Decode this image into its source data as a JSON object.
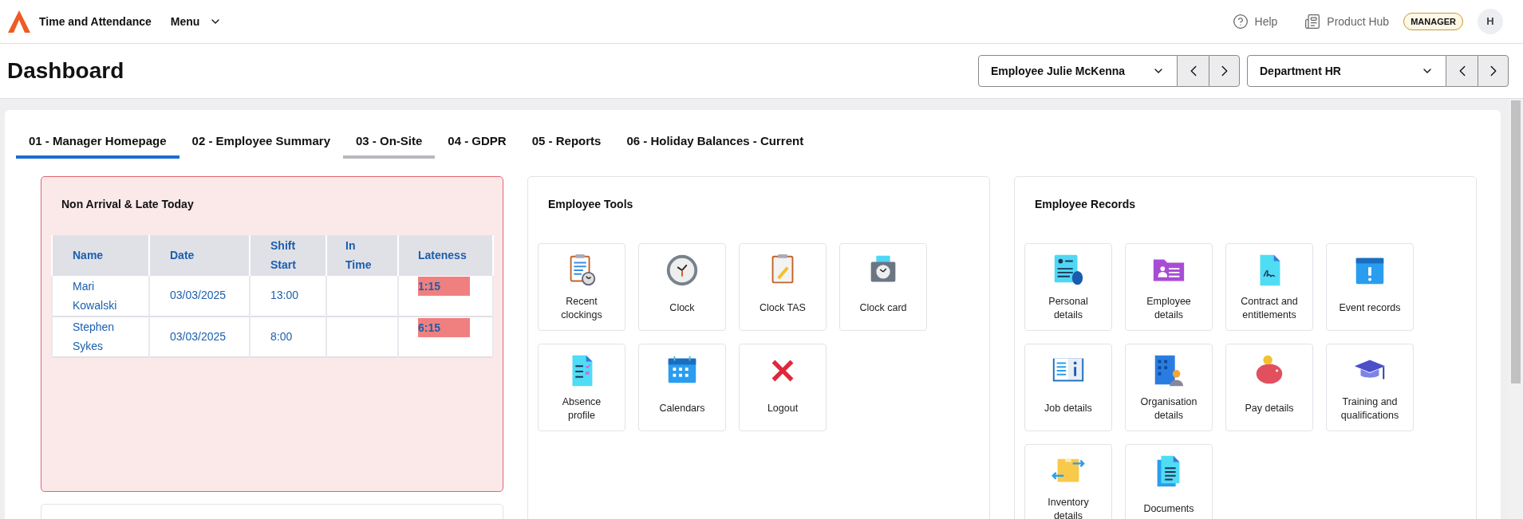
{
  "header": {
    "app_title": "Time and Attendance",
    "menu": "Menu",
    "help": "Help",
    "product_hub": "Product Hub",
    "role_badge": "MANAGER",
    "avatar": "H"
  },
  "page": {
    "title": "Dashboard",
    "employee_select": "Employee Julie McKenna",
    "department_select": "Department HR"
  },
  "tabs": [
    {
      "label": "01 - Manager Homepage",
      "selected": true,
      "hovered": false
    },
    {
      "label": "02 - Employee Summary",
      "selected": false,
      "hovered": false
    },
    {
      "label": "03 - On-Site",
      "selected": false,
      "hovered": true
    },
    {
      "label": "04 - GDPR",
      "selected": false,
      "hovered": false
    },
    {
      "label": "05 - Reports",
      "selected": false,
      "hovered": false
    },
    {
      "label": "06 - Holiday Balances - Current",
      "selected": false,
      "hovered": false
    }
  ],
  "late_panel": {
    "title": "Non Arrival & Late Today",
    "columns": [
      "Name",
      "Date",
      "Shift Start",
      "In Time",
      "Lateness"
    ],
    "rows": [
      {
        "name": "Mari Kowalski",
        "date": "03/03/2025",
        "shift_start": "13:00",
        "in_time": "",
        "lateness": "1:15"
      },
      {
        "name": "Stephen Sykes",
        "date": "03/03/2025",
        "shift_start": "8:00",
        "in_time": "",
        "lateness": "6:15"
      }
    ]
  },
  "employee_tools": {
    "title": "Employee Tools",
    "tiles": [
      "Recent clockings",
      "Clock",
      "Clock TAS",
      "Clock card",
      "Absence profile",
      "Calendars",
      "Logout"
    ]
  },
  "employee_records": {
    "title": "Employee Records",
    "tiles": [
      "Personal details",
      "Employee details",
      "Contract and entitlements",
      "Event records",
      "Job details",
      "Organisation details",
      "Pay details",
      "Training and qualifications",
      "Inventory details",
      "Documents"
    ]
  }
}
